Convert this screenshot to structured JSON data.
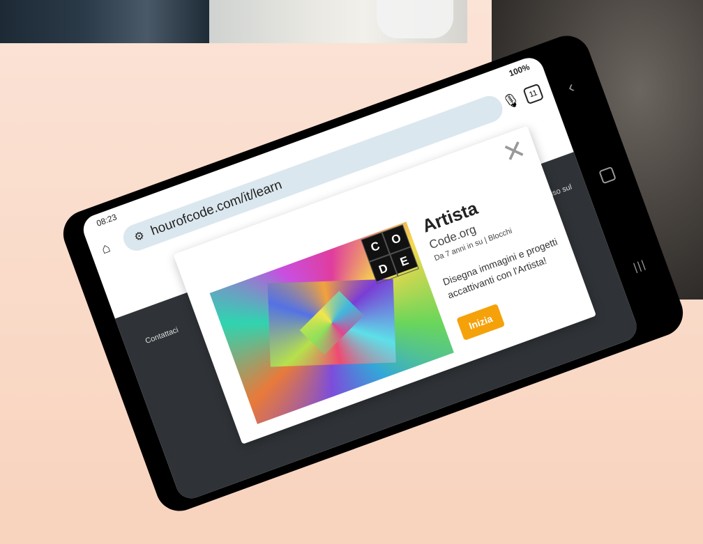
{
  "status": {
    "time": "08:23",
    "battery": "100%"
  },
  "browser": {
    "url": "hourofcode.com/it/learn",
    "tabs_count": "11"
  },
  "footer": {
    "contact": "Contattaci",
    "notice": "Avviso sul"
  },
  "card": {
    "title": "Artista",
    "publisher": "Code.org",
    "meta": "Da 7 anni in su | Blocchi",
    "description": "Disegna immagini e progetti accattivanti con l'Artista!",
    "start_label": "Inizia",
    "logo_letters": [
      "C",
      "O",
      "D",
      "E"
    ]
  },
  "colors": {
    "accent": "#f5a10a",
    "url_bar": "#dbe7ee",
    "page_dark": "#2f3337"
  }
}
